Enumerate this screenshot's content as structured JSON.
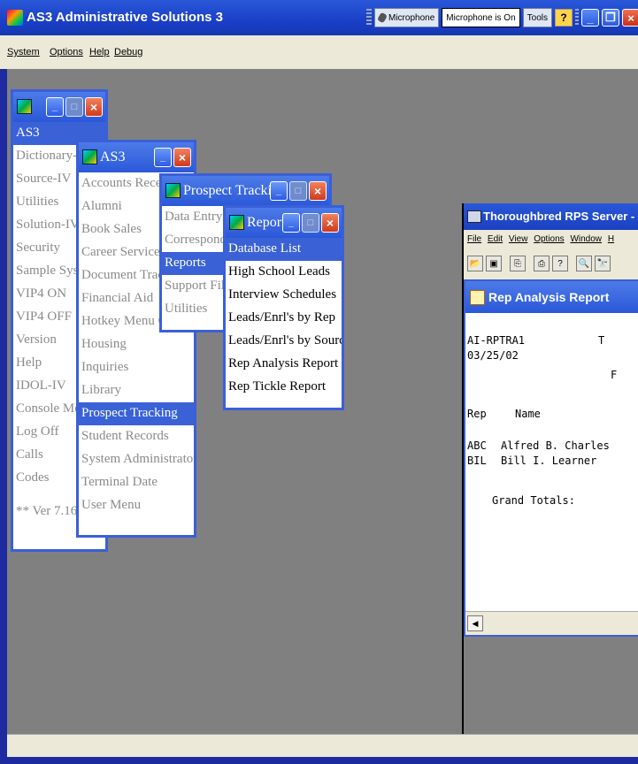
{
  "app": {
    "title": "AS3 Administrative Solutions 3",
    "language_bar": {
      "microphone": "Microphone",
      "status": "Microphone is On",
      "tools": "Tools",
      "help": "?"
    }
  },
  "menubar": [
    "System",
    "Options",
    "Help",
    "Debug"
  ],
  "windows": {
    "as3_main": {
      "items": [
        "AS3",
        "Dictionary-IV",
        "Source-IV",
        "Utilities",
        "Solution-IV",
        "Security",
        "Sample Systems",
        "VIP4 ON",
        "VIP4 OFF",
        "Version",
        "Help",
        "IDOL-IV",
        "Console Mode",
        "Log Off",
        "Calls",
        "Codes",
        "",
        "** Ver 7.16"
      ],
      "selected": "AS3"
    },
    "as3_sub": {
      "title": "AS3",
      "items": [
        "Accounts Receivable",
        "Alumni",
        "Book Sales",
        "Career Services",
        "Document Tracking",
        "Financial Aid",
        "Hotkey Menu Control",
        "Housing",
        "Inquiries",
        "Library",
        "Prospect Tracking",
        "Student Records",
        "System Administrator",
        "Terminal Date",
        "User Menu"
      ],
      "selected": "Prospect Tracking"
    },
    "prospect": {
      "title": "Prospect Tracking",
      "items": [
        "Data Entry",
        "Correspondence",
        "Reports",
        "Support Files",
        "Utilities"
      ],
      "selected": "Reports"
    },
    "reports": {
      "title": "Reports",
      "items": [
        "Database List",
        "High School Leads",
        "Interview Schedules",
        "Leads/Enrl's by Rep",
        "Leads/Enrl's by Source",
        "Rep Analysis Report",
        "Rep Tickle Report"
      ],
      "selected": "Database List"
    }
  },
  "rps": {
    "title": "Thoroughbred RPS Server - R",
    "menu": [
      "File",
      "Edit",
      "View",
      "Options",
      "Window",
      "H"
    ],
    "toolbar": [
      "open-icon",
      "save-icon",
      "copy-icon",
      "print-icon",
      "help-icon",
      "zoom-icon",
      "find-icon"
    ],
    "report": {
      "title": "Rep Analysis Report",
      "id": "AI-RPTRA1",
      "date": "03/25/02",
      "col_t": "T",
      "col_f": "F",
      "headers": {
        "rep": "Rep",
        "name": "Name"
      },
      "rows": [
        {
          "rep": "ABC",
          "name": "Alfred B. Charles"
        },
        {
          "rep": "BIL",
          "name": "Bill I. Learner"
        }
      ],
      "grand_totals": "Grand Totals:"
    }
  }
}
